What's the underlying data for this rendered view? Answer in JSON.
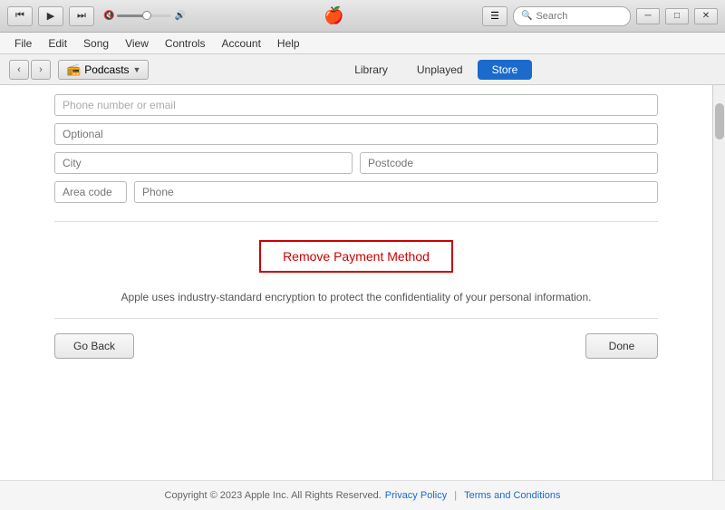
{
  "titlebar": {
    "apple_logo": "🍎",
    "search_placeholder": "Search"
  },
  "menubar": {
    "items": [
      "File",
      "Edit",
      "Song",
      "View",
      "Controls",
      "Account",
      "Help"
    ]
  },
  "navbar": {
    "podcast_icon": "📻",
    "podcast_label": "Podcasts",
    "tabs": [
      {
        "label": "Library",
        "active": false
      },
      {
        "label": "Unplayed",
        "active": false
      },
      {
        "label": "Store",
        "active": true
      }
    ]
  },
  "form": {
    "optional_placeholder": "Optional",
    "city_placeholder": "City",
    "postcode_placeholder": "Postcode",
    "areacode_placeholder": "Area code",
    "phone_placeholder": "Phone"
  },
  "remove_button": {
    "label": "Remove Payment Method"
  },
  "encryption_notice": "Apple uses industry-standard encryption to protect the confidentiality of your personal information.",
  "buttons": {
    "go_back": "Go Back",
    "done": "Done"
  },
  "footer": {
    "copyright": "Copyright © 2023 Apple Inc. All Rights Reserved.",
    "privacy": "Privacy Policy",
    "separator": "|",
    "terms": "Terms and Conditions"
  }
}
